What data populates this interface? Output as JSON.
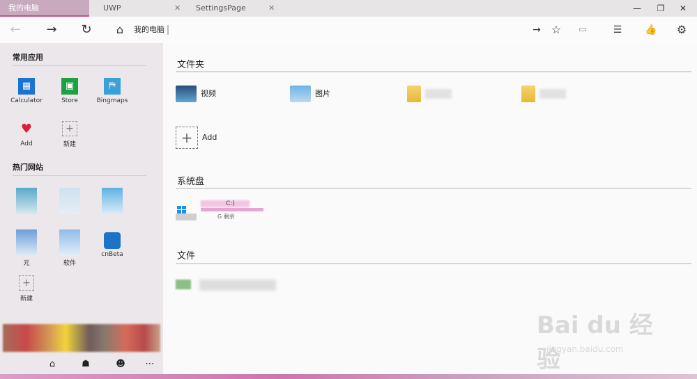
{
  "tabs": [
    {
      "label": "我的电脑"
    },
    {
      "label": "UWP",
      "close": "✕"
    },
    {
      "label": "SettingsPage",
      "close": "✕"
    }
  ],
  "window_controls": {
    "minimize": "—",
    "maximize": "❐",
    "close": "✕"
  },
  "nav": {
    "address": "我的电脑",
    "icons": [
      "back-arrow-icon",
      "forward-arrow-icon",
      "refresh-icon",
      "home-icon",
      "go-arrow-icon",
      "star-icon",
      "tab-add-icon",
      "list-icon",
      "thumbs-up-icon",
      "gear-icon"
    ]
  },
  "sidebar": {
    "apps_title": "常用应用",
    "apps": [
      {
        "label": "Calculator"
      },
      {
        "label": "Store"
      },
      {
        "label": "Bingmaps"
      },
      {
        "label": "Add"
      },
      {
        "label": "新建"
      }
    ],
    "sites_title": "热门网站",
    "sites": [
      {
        "label": ""
      },
      {
        "label": ""
      },
      {
        "label": ""
      },
      {
        "label": "元"
      },
      {
        "label": "软件"
      },
      {
        "label": "cnBeta"
      },
      {
        "label": "新建"
      }
    ]
  },
  "main": {
    "folders_title": "文件夹",
    "folders": [
      {
        "label": "视频"
      },
      {
        "label": "图片"
      }
    ],
    "add_label": "Add",
    "disks_title": "系统盘",
    "drive": {
      "name": "C:)",
      "free": "G 剩余"
    },
    "files_title": "文件"
  },
  "watermark": {
    "line1": "Bai du 经验",
    "line2": "jingyan.baidu.com"
  },
  "colors": {
    "accent": "#c0508c",
    "tab_active": "#c8a9bd",
    "sidebar": "#ebe7ea"
  }
}
